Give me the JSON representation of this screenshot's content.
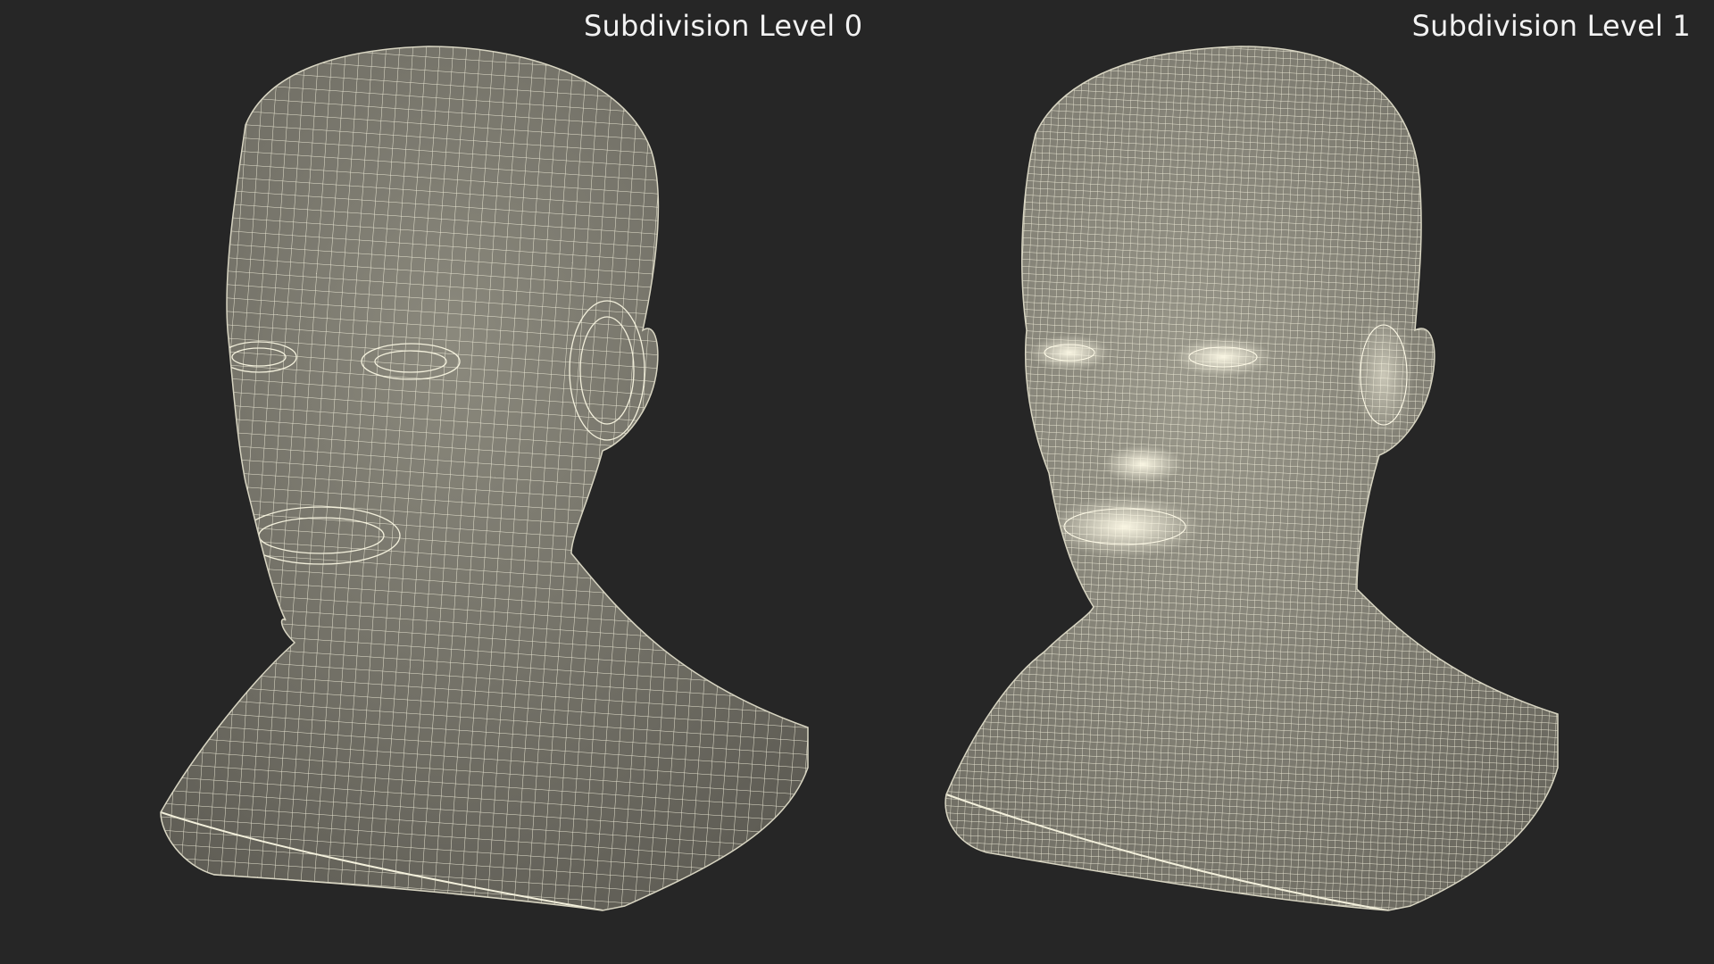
{
  "panels": [
    {
      "label": "Subdivision Level 0",
      "mesh_density": "coarse"
    },
    {
      "label": "Subdivision Level 1",
      "mesh_density": "fine"
    }
  ],
  "colors": {
    "background": "#262626",
    "mesh_fill": "#76746a",
    "wire": "#f3f0dc",
    "label": "#f2f2f2"
  }
}
